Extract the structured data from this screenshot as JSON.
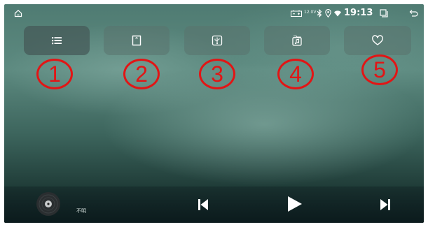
{
  "status_bar": {
    "voltage": "12.0V",
    "time": "19:13",
    "icons": [
      "home-icon",
      "battery-icon",
      "bluetooth-icon",
      "location-icon",
      "wifi-icon",
      "recent-apps-icon",
      "back-icon"
    ]
  },
  "tabs": [
    {
      "icon": "list-icon"
    },
    {
      "icon": "sd-card-icon"
    },
    {
      "icon": "usb-icon"
    },
    {
      "icon": "music-folder-icon"
    },
    {
      "icon": "heart-icon"
    }
  ],
  "markers": [
    "1",
    "2",
    "3",
    "4",
    "5"
  ],
  "player": {
    "track_title": "不明",
    "album_icon": "disc-icon",
    "controls": [
      "previous-icon",
      "play-icon",
      "next-icon"
    ]
  },
  "colors": {
    "marker": "#e21515",
    "background_top": "#4f7b72",
    "background_bottom": "#13282a",
    "text": "#ffffff"
  }
}
